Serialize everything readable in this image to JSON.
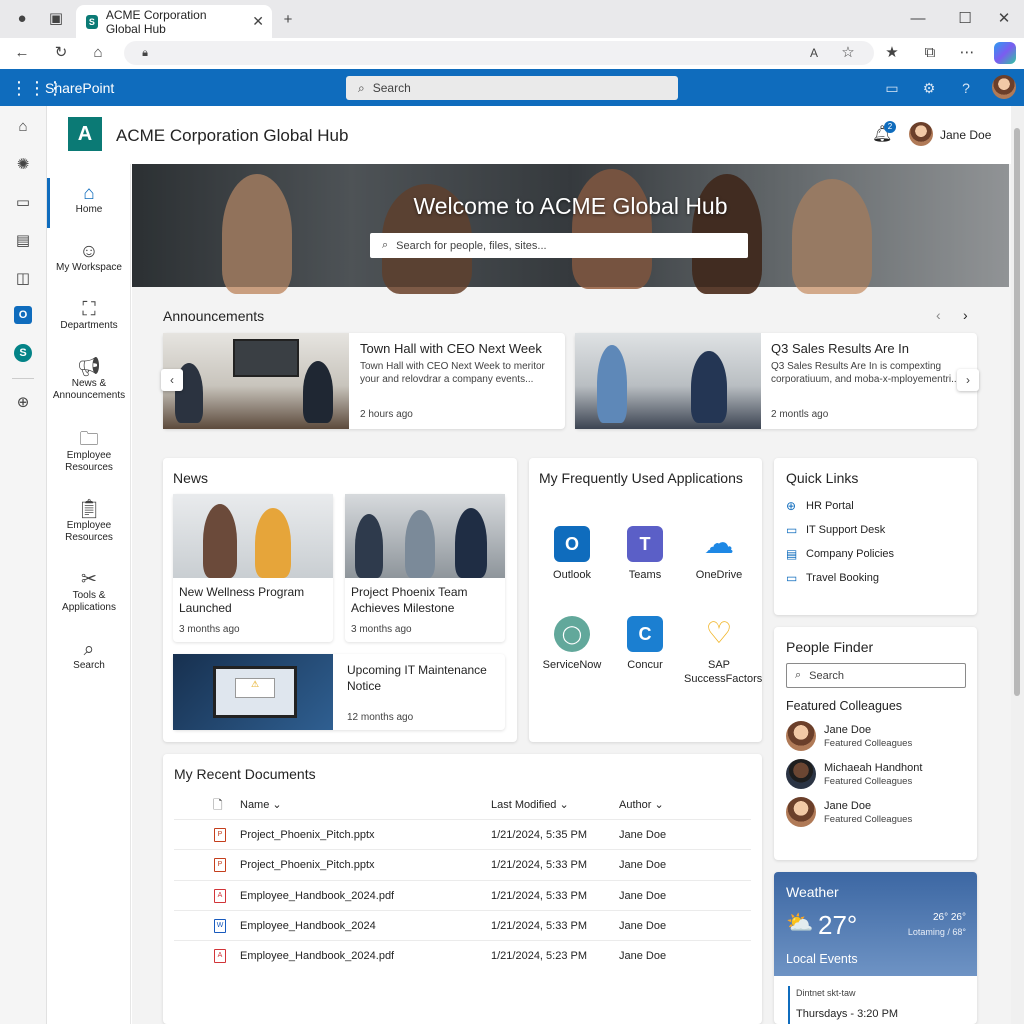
{
  "browser": {
    "tab_title": "ACME Corporation Global Hub",
    "tab_close": "✕",
    "new_tab": "+"
  },
  "suite": {
    "brand": "SharePoint",
    "search_placeholder": "Search"
  },
  "site": {
    "logo_letter": "A",
    "title": "ACME Corporation Global Hub",
    "notification_count": "2",
    "user_name": "Jane Doe"
  },
  "nav": {
    "items": [
      {
        "label": "Home"
      },
      {
        "label": "My Workspace"
      },
      {
        "label": "Departments"
      },
      {
        "label": "News & Announcements"
      },
      {
        "label": "Employee Resources"
      },
      {
        "label": "Employee Resources"
      },
      {
        "label": "Tools & Applications"
      },
      {
        "label": "Search"
      }
    ]
  },
  "hero": {
    "title": "Welcome to ACME Global Hub",
    "search_placeholder": "Search for people, files, sites..."
  },
  "announcements": {
    "title": "Announcements",
    "items": [
      {
        "title": "Town Hall with CEO Next Week",
        "desc": "Town Hall with CEO Next Week to meritor your and relovdrar a company events...",
        "time": "2 hours ago"
      },
      {
        "title": "Q3 Sales Results Are In",
        "desc": "Q3 Sales Results Are In is compexting corporatiuum, and moba-x-mployementri...",
        "time": "2 montls ago"
      }
    ]
  },
  "news": {
    "title": "News",
    "items": [
      {
        "title": "New Wellness Program Launched",
        "time": "3 months ago"
      },
      {
        "title": "Project Phoenix Team Achieves Milestone",
        "time": "3 months ago"
      },
      {
        "title": "Upcoming IT Maintenance Notice",
        "time": "12 months ago"
      }
    ]
  },
  "apps": {
    "title": "My Frequently Used Applications",
    "items": [
      {
        "label": "Outlook",
        "icon": "outlook-icon",
        "color": "#0f6cbd",
        "glyph": "O"
      },
      {
        "label": "Teams",
        "icon": "teams-icon",
        "color": "#5b5fc7",
        "glyph": "T"
      },
      {
        "label": "OneDrive",
        "icon": "onedrive-icon",
        "color": "#1e88e5",
        "glyph": "☁"
      },
      {
        "label": "ServiceNow",
        "icon": "servicenow-icon",
        "color": "#62a89b",
        "glyph": "◯"
      },
      {
        "label": "Concur",
        "icon": "concur-icon",
        "color": "#1b7fd1",
        "glyph": "C"
      },
      {
        "label": "SAP SuccessFactors",
        "icon": "sap-icon",
        "color": "#f0b323",
        "glyph": "♡"
      }
    ]
  },
  "quicklinks": {
    "title": "Quick Links",
    "items": [
      {
        "label": "HR Portal",
        "icon": "globe-icon"
      },
      {
        "label": "IT Support Desk",
        "icon": "monitor-icon"
      },
      {
        "label": "Company Policies",
        "icon": "document-icon"
      },
      {
        "label": "Travel Booking",
        "icon": "monitor-icon"
      }
    ]
  },
  "people": {
    "title": "People Finder",
    "search_placeholder": "Search",
    "featured_title": "Featured Colleagues",
    "items": [
      {
        "name": "Jane Doe",
        "role": "Featured Colleagues"
      },
      {
        "name": "Michaeah Handhont",
        "role": "Featured Colleagues"
      },
      {
        "name": "Jane Doe",
        "role": "Featured Colleagues"
      }
    ]
  },
  "docs": {
    "title": "My Recent Documents",
    "columns": {
      "name": "Name",
      "modified": "Last Modified",
      "author": "Author"
    },
    "rows": [
      {
        "name": "Project_Phoenix_Pitch.pptx",
        "modified": "1/21/2024, 5:35 PM",
        "author": "Jane Doe",
        "type": "P"
      },
      {
        "name": "Project_Phoenix_Pitch.pptx",
        "modified": "1/21/2024, 5:33 PM",
        "author": "Jane Doe",
        "type": "P"
      },
      {
        "name": "Employee_Handbook_2024.pdf",
        "modified": "1/21/2024, 5:33 PM",
        "author": "Jane Doe",
        "type": "A"
      },
      {
        "name": "Employee_Handbook_2024",
        "modified": "1/21/2024, 5:33 PM",
        "author": "Jane Doe",
        "type": "W"
      },
      {
        "name": "Employee_Handbook_2024.pdf",
        "modified": "1/21/2024, 5:23 PM",
        "author": "Jane Doe",
        "type": "A"
      }
    ]
  },
  "weather": {
    "title": "Weather",
    "temp": "27°",
    "range": "26° 26°",
    "detail": "Lotaming / 68°",
    "events_title": "Local Events",
    "event_name": "Dintnet skt-taw",
    "event_time": "Thursdays - 3:20 PM"
  }
}
